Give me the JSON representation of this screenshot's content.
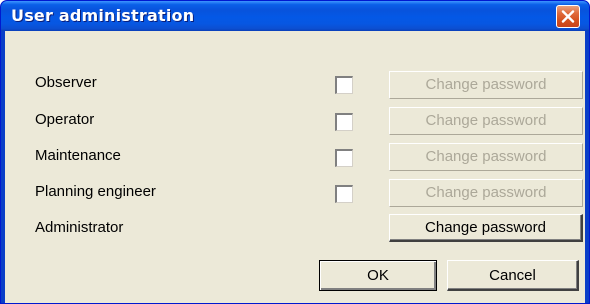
{
  "window": {
    "title": "User administration",
    "close_icon": "close-icon",
    "title_bar_color": "#0a5fe8",
    "close_button_color": "#d4501e",
    "face_color": "#ece9d8"
  },
  "roles": [
    {
      "label": "Observer",
      "has_checkbox": true,
      "checked": false,
      "change_password_label": "Change password",
      "change_password_enabled": false
    },
    {
      "label": "Operator",
      "has_checkbox": true,
      "checked": false,
      "change_password_label": "Change password",
      "change_password_enabled": false
    },
    {
      "label": "Maintenance",
      "has_checkbox": true,
      "checked": false,
      "change_password_label": "Change password",
      "change_password_enabled": false
    },
    {
      "label": "Planning engineer",
      "has_checkbox": true,
      "checked": false,
      "change_password_label": "Change password",
      "change_password_enabled": false
    },
    {
      "label": "Administrator",
      "has_checkbox": false,
      "change_password_label": "Change password",
      "change_password_enabled": true
    }
  ],
  "footer": {
    "ok_label": "OK",
    "cancel_label": "Cancel"
  }
}
